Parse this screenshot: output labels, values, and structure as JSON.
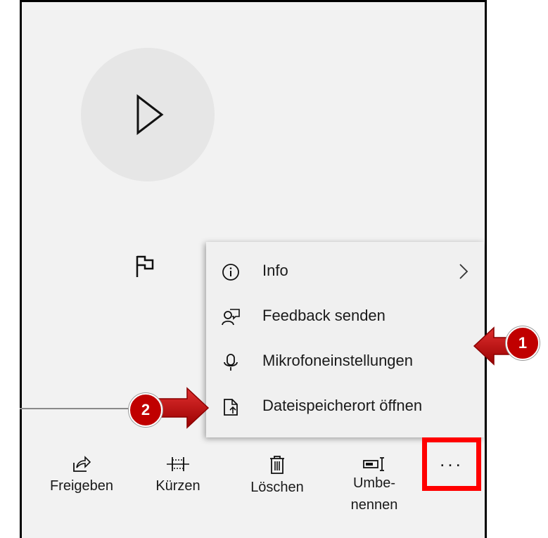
{
  "menu": {
    "items": [
      {
        "label": "Info",
        "icon": "info-icon",
        "has_submenu": true
      },
      {
        "label": "Feedback senden",
        "icon": "feedback-icon"
      },
      {
        "label": "Mikrofoneinstellungen",
        "icon": "microphone-icon"
      },
      {
        "label": "Dateispeicherort öffnen",
        "icon": "open-file-location-icon"
      }
    ]
  },
  "toolbar": {
    "share_label": "Freigeben",
    "trim_label": "Kürzen",
    "delete_label": "Löschen",
    "rename_label_line1": "Umbe-",
    "rename_label_line2": "nennen",
    "more_label": "..."
  },
  "annotations": {
    "badge_1": "1",
    "badge_2": "2",
    "color": "#c00000",
    "highlight_color": "#ff0000"
  }
}
